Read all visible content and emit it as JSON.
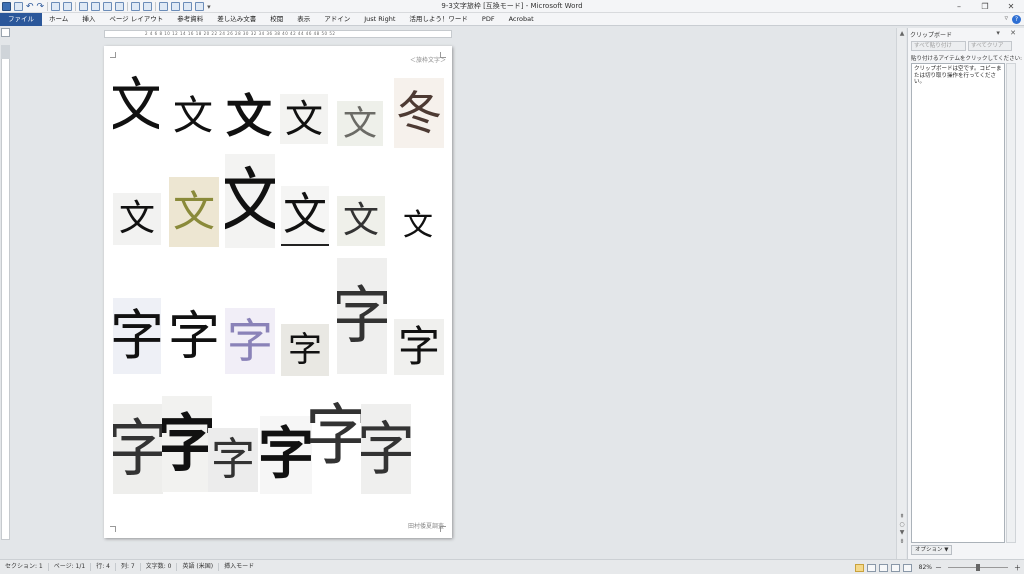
{
  "window": {
    "title": "9-3文字旅枠 [互換モード] - Microsoft Word"
  },
  "qat": {
    "undo": "↶",
    "redo": "↷",
    "more": "▾"
  },
  "window_controls": {
    "minimize": "–",
    "restore": "❐",
    "close": "✕"
  },
  "ribbon": {
    "tabs": [
      "ファイル",
      "ホーム",
      "挿入",
      "ページ レイアウト",
      "参考資料",
      "差し込み文書",
      "校閲",
      "表示",
      "アドイン",
      "Just Right",
      "活用しよう！ワード",
      "PDF",
      "Acrobat"
    ],
    "help": "?",
    "minimize": "▿"
  },
  "ruler": {
    "numbers": "2 4 6 8 10 12 14 16 18 20 22 24 26 28 30 32 34 36 38 40 42 44 46 48 50 52"
  },
  "document": {
    "header_text": "＜旅枠文字＞",
    "footer_text": "田村倭夏調査",
    "glyph_rows": [
      [
        "文",
        "文",
        "文",
        "文",
        "文",
        "冬"
      ],
      [
        "文",
        "文",
        "文",
        "文",
        "文",
        "文"
      ],
      [
        "字",
        "字",
        "字",
        "字",
        "字",
        "字"
      ],
      [
        "字",
        "字",
        "字",
        "字",
        "字",
        "字"
      ]
    ]
  },
  "scrollbar": {
    "up": "▲",
    "down": "▼",
    "prev": "⇞",
    "select": "○",
    "next": "⇟"
  },
  "clipboard_panel": {
    "title": "クリップボード",
    "controls": "▾ ✕",
    "paste_all": "すべて貼り付け",
    "clear_all": "すべてクリア",
    "hint": "貼り付けるアイテムをクリックしてください:",
    "empty_message": "クリップボードは空です。コピーまたは切り取り操作を行ってください。",
    "options_button": "オプション ▼"
  },
  "status_bar": {
    "section": "セクション: 1",
    "page": "ページ: 1/1",
    "line": "行: 4",
    "column": "列: 7",
    "word_count": "文字数: 0",
    "language": "英語 (米国)",
    "mode": "挿入モード",
    "zoom": "82%",
    "zoom_minus": "－",
    "zoom_plus": "＋"
  }
}
